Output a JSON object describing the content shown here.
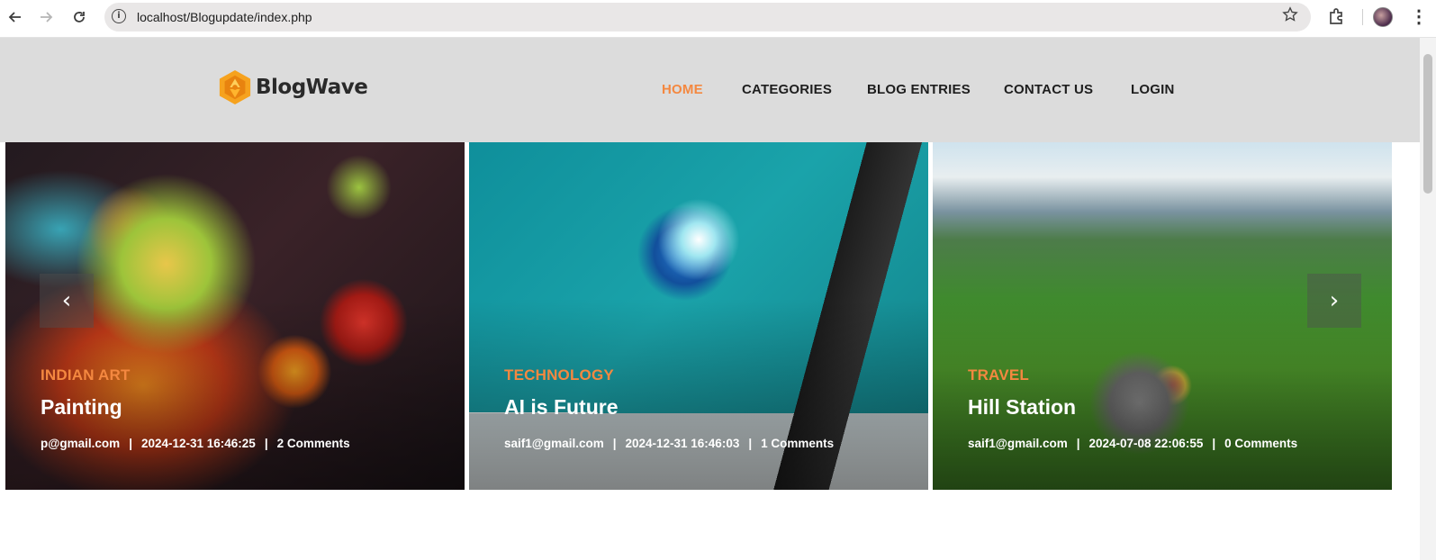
{
  "browser": {
    "url": "localhost/Blogupdate/index.php",
    "back_icon": "back-arrow-icon",
    "forward_icon": "forward-arrow-icon",
    "reload_icon": "reload-icon",
    "info_icon": "i"
  },
  "site": {
    "brand": "BlogWave",
    "accent": "#f48840",
    "nav": [
      {
        "label": "HOME",
        "active": true
      },
      {
        "label": "CATEGORIES",
        "active": false
      },
      {
        "label": "BLOG ENTRIES",
        "active": false
      },
      {
        "label": "CONTACT US",
        "active": false
      },
      {
        "label": "LOGIN",
        "active": false
      }
    ]
  },
  "slider": {
    "prev_label": "‹",
    "next_label": "›",
    "slides": [
      {
        "category": "INDIAN ART",
        "title": "Painting",
        "author": "p@gmail.com",
        "date": "2024-12-31 16:46:25",
        "comments": "2 Comments"
      },
      {
        "category": "TECHNOLOGY",
        "title": "AI is Future",
        "author": "saif1@gmail.com",
        "date": "2024-12-31 16:46:03",
        "comments": "1 Comments"
      },
      {
        "category": "TRAVEL",
        "title": "Hill Station",
        "author": "saif1@gmail.com",
        "date": "2024-07-08 22:06:55",
        "comments": "0 Comments"
      }
    ]
  }
}
